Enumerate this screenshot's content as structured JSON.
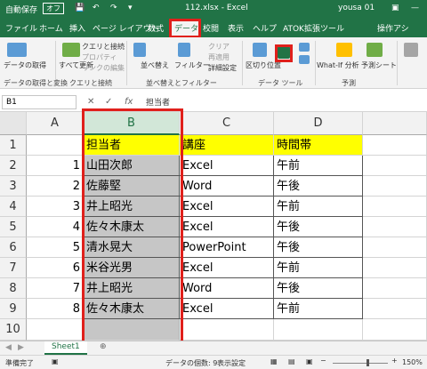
{
  "titlebar": {
    "autosave": "自動保存",
    "autosave_state": "オフ",
    "filename": "112.xlsx - Excel",
    "user": "yousa 01"
  },
  "tabs": [
    "ファイル",
    "ホーム",
    "挿入",
    "ページ レイアウト",
    "数式",
    "データ",
    "校閲",
    "表示",
    "ヘルプ",
    "ATOK拡張ツール",
    "操作アシ"
  ],
  "ribbon": {
    "get_data": "データの取得",
    "refresh_all": "すべて更新",
    "queries": "クエリと接続",
    "properties": "プロパティ",
    "edit_links": "リンクの編集",
    "sort": "並べ替え",
    "filter": "フィルター",
    "clear": "クリア",
    "reapply": "再適用",
    "advanced": "詳細設定",
    "text_to_columns": "区切り位置",
    "whatif": "What-If 分析",
    "forecast": "予測シート",
    "group_get": "データの取得と変換",
    "group_queries": "クエリと接続",
    "group_sort": "並べ替えとフィルター",
    "group_tools": "データ ツール",
    "group_forecast": "予測"
  },
  "formula_bar": {
    "name_box": "B1",
    "fx": "fx",
    "value": "担当者"
  },
  "columns": [
    "A",
    "B",
    "C",
    "D"
  ],
  "rows": [
    "1",
    "2",
    "3",
    "4",
    "5",
    "6",
    "7",
    "8",
    "9",
    "10"
  ],
  "cells": [
    [
      "",
      "担当者",
      "講座",
      "時間帯"
    ],
    [
      "1",
      "山田次郎",
      "Excel",
      "午前"
    ],
    [
      "2",
      "佐藤堅",
      "Word",
      "午後"
    ],
    [
      "3",
      "井上昭光",
      "Excel",
      "午前"
    ],
    [
      "4",
      "佐々木康太",
      "Excel",
      "午後"
    ],
    [
      "5",
      "清水晃大",
      "PowerPoint",
      "午後"
    ],
    [
      "6",
      "米谷光男",
      "Excel",
      "午前"
    ],
    [
      "7",
      "井上昭光",
      "Word",
      "午後"
    ],
    [
      "8",
      "佐々木康太",
      "Excel",
      "午前"
    ],
    [
      "",
      "",
      "",
      ""
    ]
  ],
  "sheet_tab": "Sheet1",
  "status": {
    "ready": "準備完了",
    "count": "データの個数: 9",
    "display_settings": "表示設定",
    "zoom": "150%"
  },
  "colors": {
    "accent": "#217346",
    "header_fill": "#ffff00",
    "selection": "#c6c6c6",
    "highlight": "#e0201b"
  }
}
